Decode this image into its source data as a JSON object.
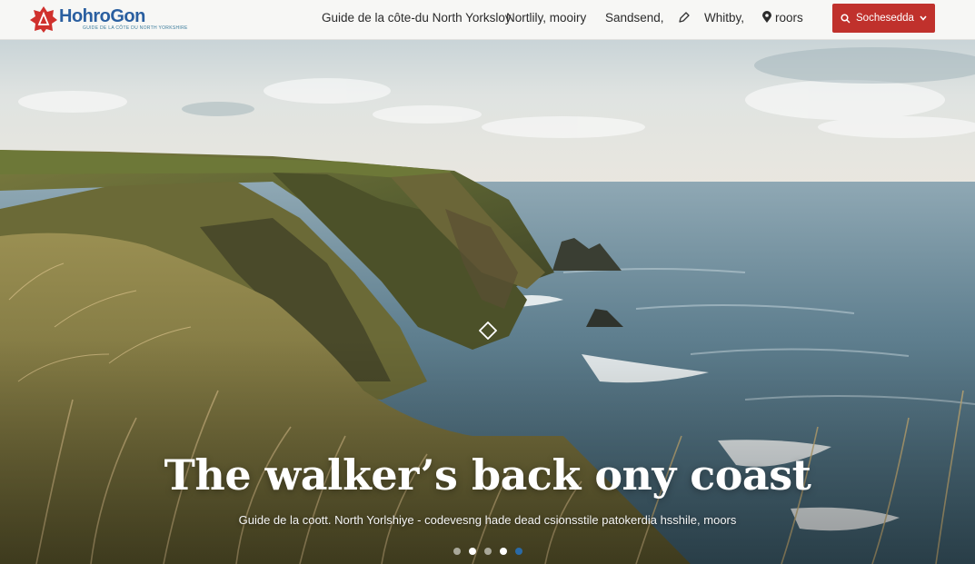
{
  "brand": {
    "name": "HohroGon",
    "tagline": "GUIDE DE LA CÔTE DU NORTH YORKSHIRE",
    "logo_color": "#d0312d"
  },
  "nav": {
    "items": [
      {
        "label": "Guide de la côte-du North Yorksloy"
      },
      {
        "label": "Nortlily, mooiry"
      },
      {
        "label": "Sandsend,"
      },
      {
        "label": "Whitby,",
        "icon": "pencil-icon"
      },
      {
        "label": "roors",
        "icon": "location-pin-icon"
      }
    ],
    "cta": {
      "label": "Sochesedda",
      "icon": "search-icon",
      "color": "#c0312c"
    }
  },
  "hero": {
    "title": "The walker’s back ony coast",
    "subtitle": "Guide de la coott. North Yorlshiye - codevesng hade dead csionsstile patokerdia hsshile, moors",
    "slides": 5,
    "active_slide": 4
  }
}
